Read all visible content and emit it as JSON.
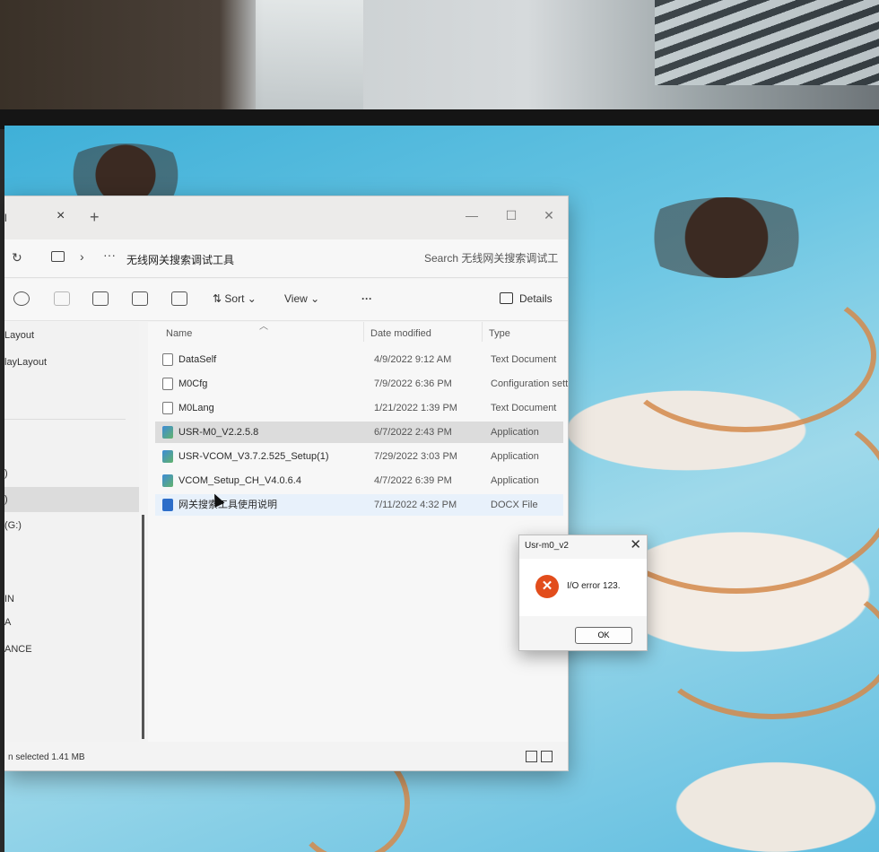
{
  "tab": {
    "label": "l"
  },
  "window_controls": {
    "minimize": "—",
    "maximize": "☐",
    "close": "✕"
  },
  "address": {
    "refresh_icon": "↻",
    "chevron": "›",
    "more": "···",
    "breadcrumb": "无线网关搜索调试工具",
    "search_placeholder": "Search 无线网关搜索调试工"
  },
  "commandbar": {
    "sort_label": "⇅ Sort ⌄",
    "view_label": "View ⌄",
    "more_label": "···",
    "details_label": "Details"
  },
  "nav": {
    "items": [
      "Layout",
      "layLayout",
      ")",
      ")",
      "(G:)",
      "IN",
      "A",
      "ANCE"
    ]
  },
  "columns": {
    "name": "Name",
    "date": "Date modified",
    "type": "Type"
  },
  "files": [
    {
      "name": "DataSelf",
      "date": "4/9/2022 9:12 AM",
      "type": "Text Document",
      "icon": "text-file-icon"
    },
    {
      "name": "M0Cfg",
      "date": "7/9/2022 6:36 PM",
      "type": "Configuration sett",
      "icon": "config-file-icon"
    },
    {
      "name": "M0Lang",
      "date": "1/21/2022 1:39 PM",
      "type": "Text Document",
      "icon": "text-file-icon"
    },
    {
      "name": "USR-M0_V2.2.5.8",
      "date": "6/7/2022 2:43 PM",
      "type": "Application",
      "icon": "app-icon"
    },
    {
      "name": "USR-VCOM_V3.7.2.525_Setup(1)",
      "date": "7/29/2022 3:03 PM",
      "type": "Application",
      "icon": "app-icon"
    },
    {
      "name": "VCOM_Setup_CH_V4.0.6.4",
      "date": "4/7/2022 6:39 PM",
      "type": "Application",
      "icon": "app-icon"
    },
    {
      "name": "网关搜索工具使用说明",
      "date": "7/11/2022 4:32 PM",
      "type": "DOCX File",
      "icon": "word-doc-icon"
    }
  ],
  "status": {
    "text": "n selected  1.41 MB"
  },
  "dialog": {
    "title": "Usr-m0_v2",
    "close": "✕",
    "error_icon": "✕",
    "message": "I/O error 123.",
    "ok_label": "OK"
  },
  "colors": {
    "error": "#e24d1c",
    "accent_blue": "#2d6ec9",
    "selection": "#dcdcdc"
  }
}
